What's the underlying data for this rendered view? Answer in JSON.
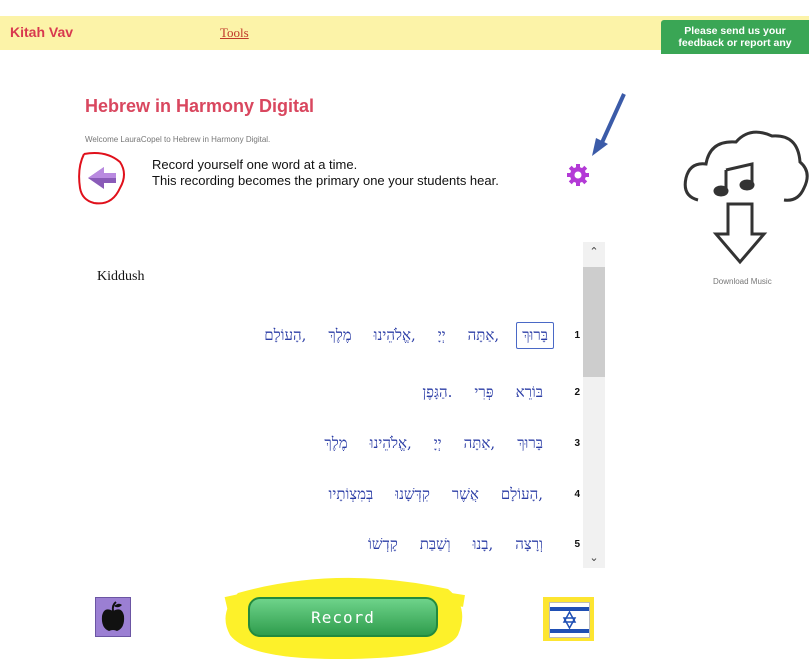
{
  "header": {
    "brand": "Kitah Vav",
    "tools_link": "Tools",
    "feedback_button": "Please send us your feedback or report any"
  },
  "page": {
    "title": "Hebrew in Harmony Digital",
    "welcome": "Welcome LauraCopel to Hebrew in Harmony Digital.",
    "instructions": [
      "Record yourself one word at a time.",
      "This recording becomes the primary one your students hear."
    ]
  },
  "sidebar": {
    "download_label": "Download Music"
  },
  "passage": {
    "title": "Kiddush",
    "lines": [
      {
        "num": "1",
        "words": [
          "בָּרוּךְ",
          "אַתָּה,",
          "יְיָ",
          "אֱלֹהֵינוּ,",
          "מֶלֶךְ",
          "הָעוֹלָם,"
        ]
      },
      {
        "num": "2",
        "words": [
          "בּוֹרֵא",
          "פְּרִי",
          "הַגָּפֶן."
        ]
      },
      {
        "num": "3",
        "words": [
          "בָּרוּךְ",
          "אַתָּה,",
          "יְיָ",
          "אֱלֹהֵינוּ,",
          "מֶלֶךְ"
        ]
      },
      {
        "num": "4",
        "words": [
          "הָעוֹלָם,",
          "אֲשֶׁר",
          "קִדְּשָׁנוּ",
          "בְּמִצְוֹתָיו"
        ]
      },
      {
        "num": "5",
        "words": [
          "וְרָצָה",
          "בָנוּ,",
          "וְשַׁבַּת",
          "קָדְשׁוֹ"
        ]
      }
    ]
  },
  "controls": {
    "record_button": "Record"
  },
  "colors": {
    "brand": "#d8384f",
    "header_bg": "#fcf3a8",
    "feedback_bg": "#3aa655",
    "hebrew_text": "#2c3ea6",
    "record_green": "#2f9d4d",
    "highlight_yellow": "#fdf12a"
  },
  "icons": {
    "back": "arrow-left-icon",
    "settings": "gear-icon",
    "download": "cloud-download-icon",
    "apple": "apple-icon",
    "flag": "israel-flag-icon",
    "pointer": "pointer-arrow-icon"
  }
}
